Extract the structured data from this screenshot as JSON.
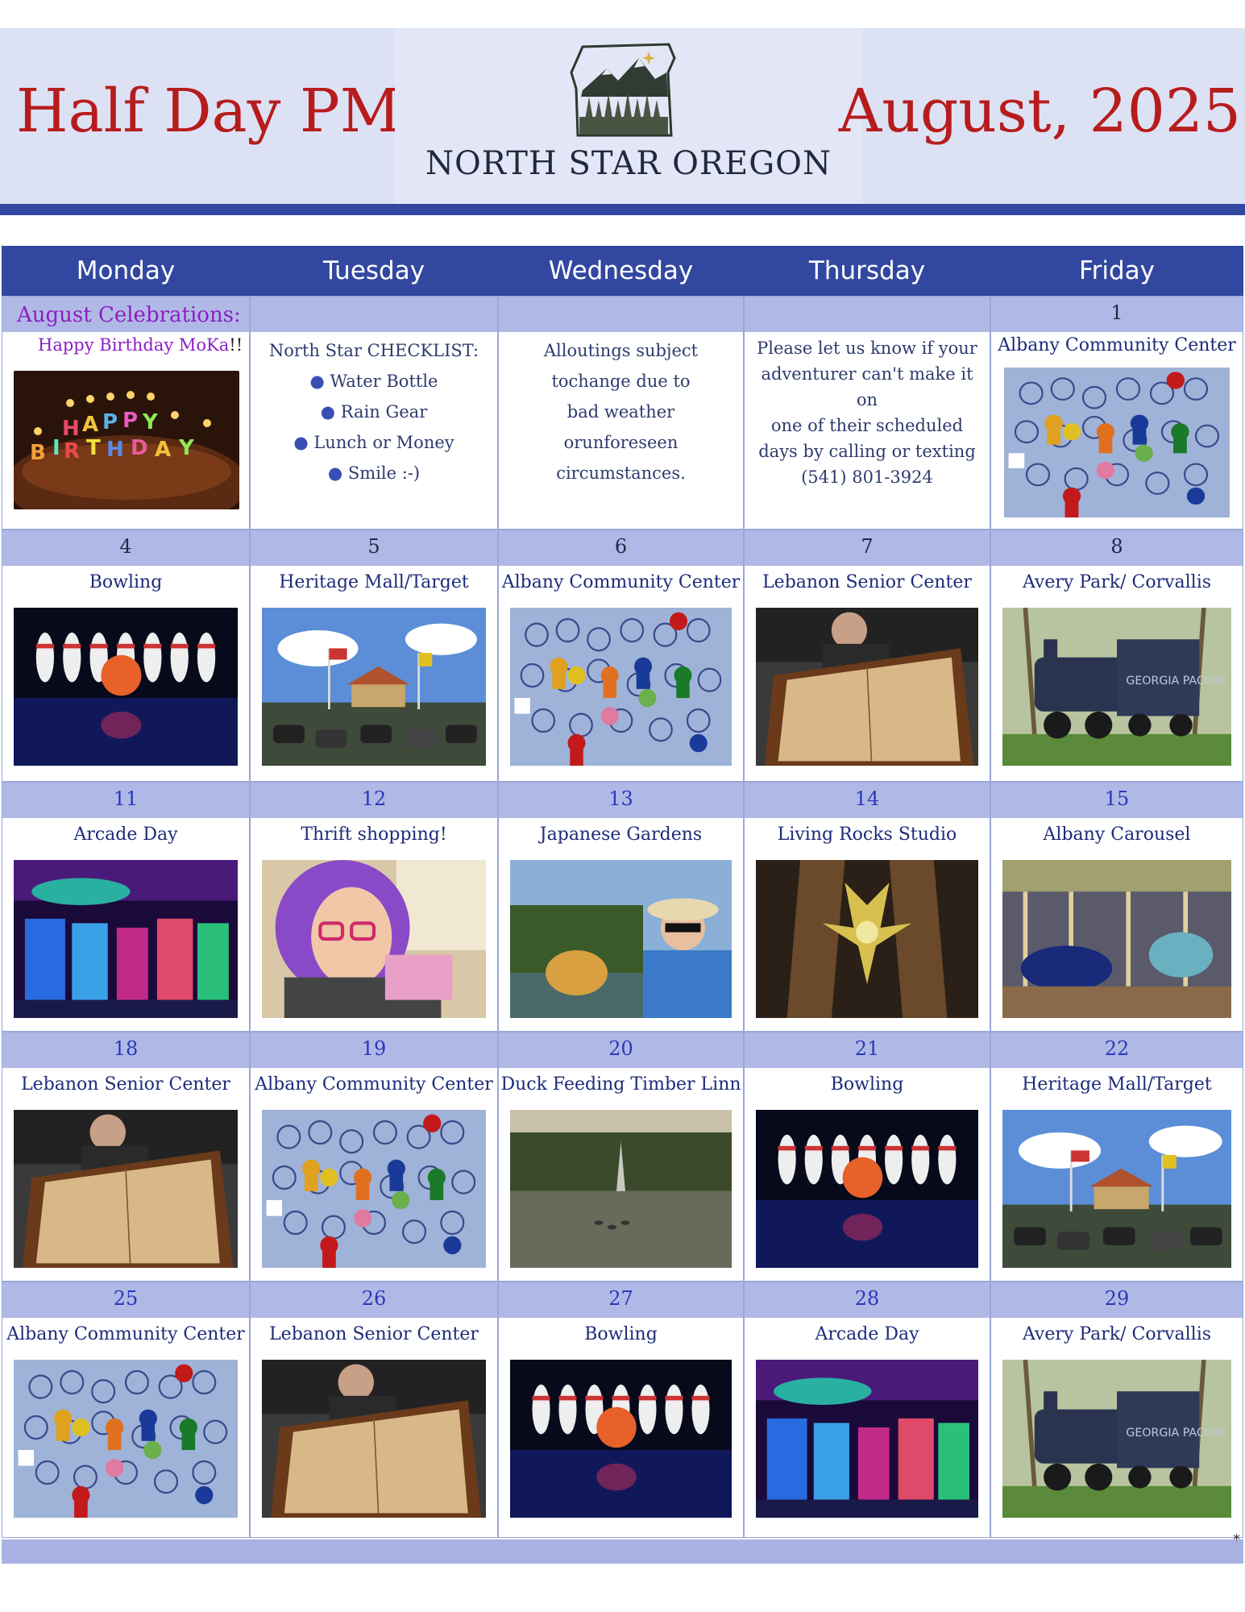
{
  "header": {
    "left_title": "Half Day PM",
    "right_title": "August, 2025",
    "logo_text": "NORTH STAR OREGON"
  },
  "weekdays": [
    "Monday",
    "Tuesday",
    "Wednesday",
    "Thursday",
    "Friday"
  ],
  "week1": {
    "celebrations_title": "August Celebrations:",
    "birthday_text": "Happy Birthday MoKa",
    "birthday_exclaim": "!!",
    "checklist_title": "North Star CHECKLIST:",
    "checklist": [
      "Water Bottle",
      "Rain Gear",
      "Lunch or Money",
      "Smile :-)"
    ],
    "weather_note": [
      "Alloutings subject",
      "tochange due to",
      "bad weather",
      "orunforeseen",
      "circumstances."
    ],
    "contact_note": [
      "Please let us know if your",
      "adventurer can't make it",
      "on",
      "one of their scheduled",
      "days by calling or texting",
      "(541) 801-3924"
    ],
    "friday_num": "1",
    "friday_activity": "Albany Community Center"
  },
  "weeks": [
    [
      {
        "num": "4",
        "activity": "Bowling",
        "img": "bowling"
      },
      {
        "num": "5",
        "activity": "Heritage Mall/Target",
        "img": "mall"
      },
      {
        "num": "6",
        "activity": "Albany Community Center",
        "img": "board"
      },
      {
        "num": "7",
        "activity": "Lebanon Senior Center",
        "img": "shuffle"
      },
      {
        "num": "8",
        "activity": "Avery Park/ Corvallis",
        "img": "train"
      }
    ],
    [
      {
        "num": "11",
        "activity": "Arcade Day",
        "img": "arcade"
      },
      {
        "num": "12",
        "activity": "Thrift shopping!",
        "img": "thrift"
      },
      {
        "num": "13",
        "activity": "Japanese Gardens",
        "img": "garden"
      },
      {
        "num": "14",
        "activity": "Living Rocks Studio",
        "img": "rocks"
      },
      {
        "num": "15",
        "activity": "Albany Carousel",
        "img": "carousel"
      }
    ],
    [
      {
        "num": "18",
        "activity": "Lebanon Senior Center",
        "img": "shuffle"
      },
      {
        "num": "19",
        "activity": "Albany Community Center",
        "img": "board"
      },
      {
        "num": "20",
        "activity": "Duck Feeding Timber Linn",
        "img": "pond"
      },
      {
        "num": "21",
        "activity": "Bowling",
        "img": "bowling"
      },
      {
        "num": "22",
        "activity": "Heritage Mall/Target",
        "img": "mall"
      }
    ],
    [
      {
        "num": "25",
        "activity": "Albany Community Center",
        "img": "board"
      },
      {
        "num": "26",
        "activity": "Lebanon Senior Center",
        "img": "shuffle"
      },
      {
        "num": "27",
        "activity": "Bowling",
        "img": "bowling"
      },
      {
        "num": "28",
        "activity": "Arcade Day",
        "img": "arcade"
      },
      {
        "num": "29",
        "activity": "Avery Park/ Corvallis",
        "img": "train"
      }
    ]
  ],
  "footer_mark": "*"
}
